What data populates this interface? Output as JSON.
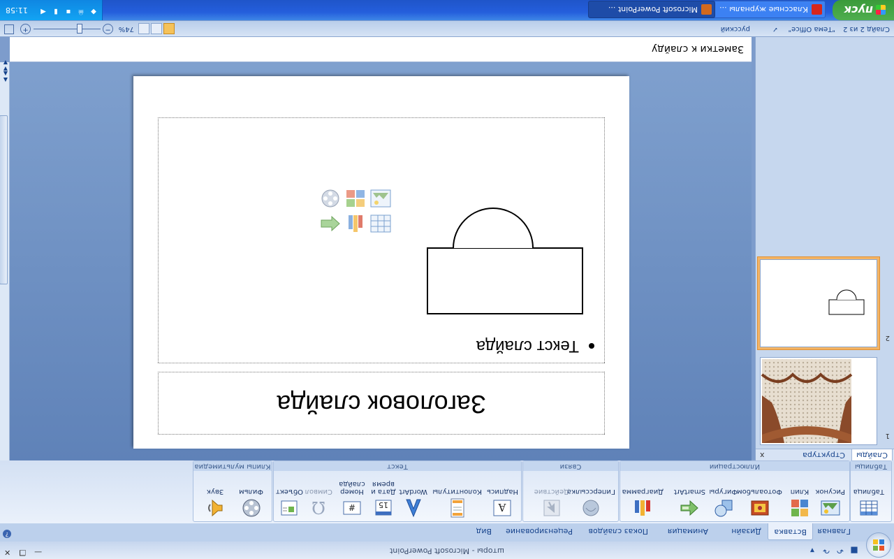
{
  "app": {
    "title": "шторы - Microsoft PowerPoint",
    "qat_icons": [
      "save-icon",
      "undo-icon",
      "redo-icon",
      "customize-icon"
    ]
  },
  "ribbon": {
    "tabs": [
      "Главная",
      "Вставка",
      "Дизайн",
      "Анимация",
      "Показ слайдов",
      "Рецензирование",
      "Вид"
    ],
    "active_tab": "Вставка",
    "groups": {
      "tables": {
        "label": "Таблицы",
        "table": "Таблица"
      },
      "illustrations": {
        "label": "Иллюстрации",
        "picture": "Рисунок",
        "clip": "Клип",
        "album": "Фотоальбом",
        "shapes": "Фигуры",
        "smartart": "SmartArt",
        "chart": "Диаграмма"
      },
      "links": {
        "label": "Связи",
        "hyperlink": "Гиперссылка",
        "action": "Действие"
      },
      "text": {
        "label": "Текст",
        "textbox": "Надпись",
        "header_footer": "Колонтитулы",
        "wordart": "WordArt",
        "datetime": "Дата и время",
        "slide_number": "Номер слайда",
        "symbol": "Символ",
        "object": "Объект"
      },
      "media": {
        "label": "Клипы мультимедиа",
        "movie": "Фильм",
        "sound": "Звук"
      }
    }
  },
  "left_panel": {
    "tabs": [
      "Слайды",
      "Структура"
    ],
    "close": "x",
    "slides": [
      {
        "num": "1",
        "type": "photo"
      },
      {
        "num": "2",
        "type": "shapes"
      }
    ],
    "selected": 2
  },
  "slide": {
    "title": "Заголовок слайда",
    "body_text": "Текст слайда",
    "content_icons": [
      "table-icon",
      "chart-icon",
      "smartart-icon",
      "picture-icon",
      "clipart-icon",
      "media-icon"
    ]
  },
  "notes": {
    "placeholder": "Заметки к слайду"
  },
  "status": {
    "slide_info": "Слайд 2 из 2",
    "theme": "\"Тема Office\"",
    "language": "русский",
    "zoom": "74%"
  },
  "taskbar": {
    "start": "пуск",
    "tasks": [
      "Классные журналы ...",
      "Microsoft PowerPoint ..."
    ],
    "clock": "11:58"
  }
}
